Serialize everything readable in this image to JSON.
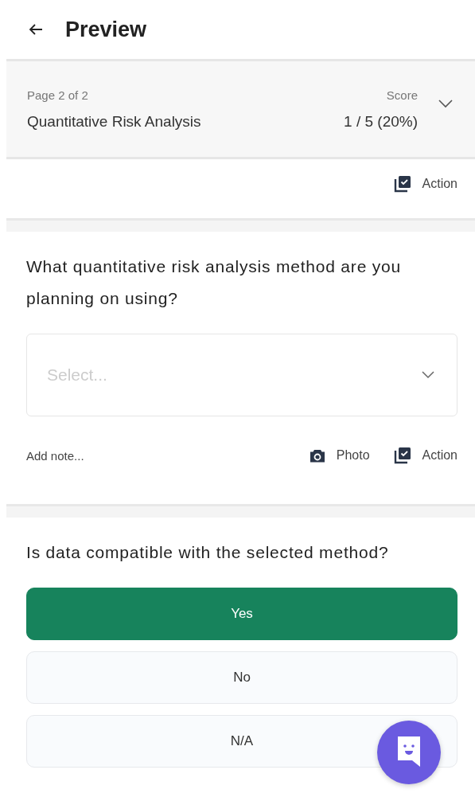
{
  "header": {
    "title": "Preview"
  },
  "page_summary": {
    "page": "Page 2 of 2",
    "section": "Quantitative Risk Analysis",
    "score_label": "Score",
    "score": "1 / 5 (20%)",
    "expanded": false
  },
  "section_action": {
    "label": "Action"
  },
  "questions": [
    {
      "kind": "select",
      "text": "What quantitative risk analysis method are you planning on using?",
      "placeholder": "Select...",
      "note_placeholder": "Add note...",
      "photo_label": "Photo",
      "action_label": "Action"
    },
    {
      "kind": "choice",
      "text": "Is data compatible with the selected method?",
      "options": [
        {
          "label": "Yes",
          "selected": true
        },
        {
          "label": "No",
          "selected": false
        },
        {
          "label": "N/A",
          "selected": false
        }
      ]
    }
  ]
}
